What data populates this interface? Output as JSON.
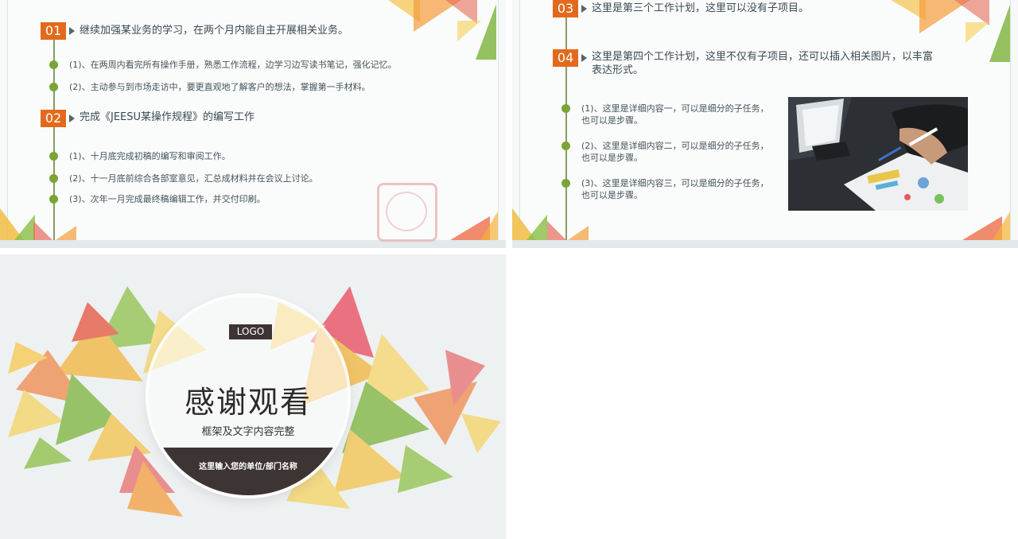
{
  "slide_a": {
    "sections": [
      {
        "num": "01",
        "title": "继续加强某业务的学习，在两个月内能自主开展相关业务。",
        "items": [
          "(1)、在两周内看完所有操作手册，熟悉工作流程，边学习边写读书笔记，强化记忆。",
          "(2)、主动参与到市场走访中，要更直观地了解客户的想法，掌握第一手材料。"
        ]
      },
      {
        "num": "02",
        "title": "完成《JEESU某操作规程》的编写工作",
        "items": [
          "(1)、十月底完成初稿的编写和审阅工作。",
          "(2)、十一月底前综合各部室意见，汇总成材料并在会议上讨论。",
          "(3)、次年一月完成最终稿编辑工作，并交付印刷。"
        ]
      }
    ]
  },
  "slide_b": {
    "sections": [
      {
        "num": "03",
        "title": "这里是第三个工作计划，这里可以没有子项目。"
      },
      {
        "num": "04",
        "title_line1": "这里是第四个工作计划，这里不仅有子项目，还可以插入相关图片，以丰富",
        "title_line2": "表达形式。",
        "items": [
          {
            "line1": "(1)、这里是详细内容一，可以是细分的子任务，",
            "line2": "也可以是步骤。"
          },
          {
            "line1": "(2)、这里是详细内容二，可以是细分的子任务，",
            "line2": "也可以是步骤。"
          },
          {
            "line1": "(3)、这里是详细内容三，可以是细分的子任务，",
            "line2": "也可以是步骤。"
          }
        ]
      }
    ]
  },
  "slide_c": {
    "logo": "LOGO",
    "title": "感谢观看",
    "subtitle": "框架及文字内容完整",
    "unit": "这里输入您的单位/部门名称"
  },
  "colors": {
    "badge": "#e36a1c",
    "bullet": "#7aa535",
    "dark": "#3d3533"
  }
}
